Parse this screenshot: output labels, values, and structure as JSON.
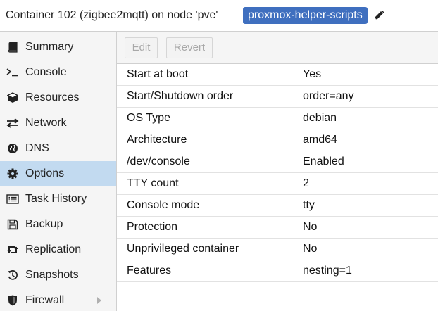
{
  "header": {
    "title": "Container 102 (zigbee2mqtt) on node 'pve'",
    "tag": "proxmox-helper-scripts",
    "tag_color": "#3f6fbf",
    "edit_icon": "pencil-icon"
  },
  "sidebar": {
    "active_color": "#c2daf0",
    "items": [
      {
        "label": "Summary",
        "icon": "book-icon"
      },
      {
        "label": "Console",
        "icon": "terminal-icon"
      },
      {
        "label": "Resources",
        "icon": "cube-icon"
      },
      {
        "label": "Network",
        "icon": "exchange-icon"
      },
      {
        "label": "DNS",
        "icon": "globe-icon"
      },
      {
        "label": "Options",
        "icon": "gear-icon",
        "active": true
      },
      {
        "label": "Task History",
        "icon": "list-icon"
      },
      {
        "label": "Backup",
        "icon": "floppy-disk-icon"
      },
      {
        "label": "Replication",
        "icon": "retweet-icon"
      },
      {
        "label": "Snapshots",
        "icon": "history-icon"
      },
      {
        "label": "Firewall",
        "icon": "shield-icon",
        "expandable": true
      }
    ]
  },
  "toolbar": {
    "edit_label": "Edit",
    "revert_label": "Revert"
  },
  "options": [
    {
      "key": "Start at boot",
      "value": "Yes"
    },
    {
      "key": "Start/Shutdown order",
      "value": "order=any"
    },
    {
      "key": "OS Type",
      "value": "debian"
    },
    {
      "key": "Architecture",
      "value": "amd64"
    },
    {
      "key": "/dev/console",
      "value": "Enabled"
    },
    {
      "key": "TTY count",
      "value": "2"
    },
    {
      "key": "Console mode",
      "value": "tty"
    },
    {
      "key": "Protection",
      "value": "No"
    },
    {
      "key": "Unprivileged container",
      "value": "No"
    },
    {
      "key": "Features",
      "value": "nesting=1"
    }
  ]
}
